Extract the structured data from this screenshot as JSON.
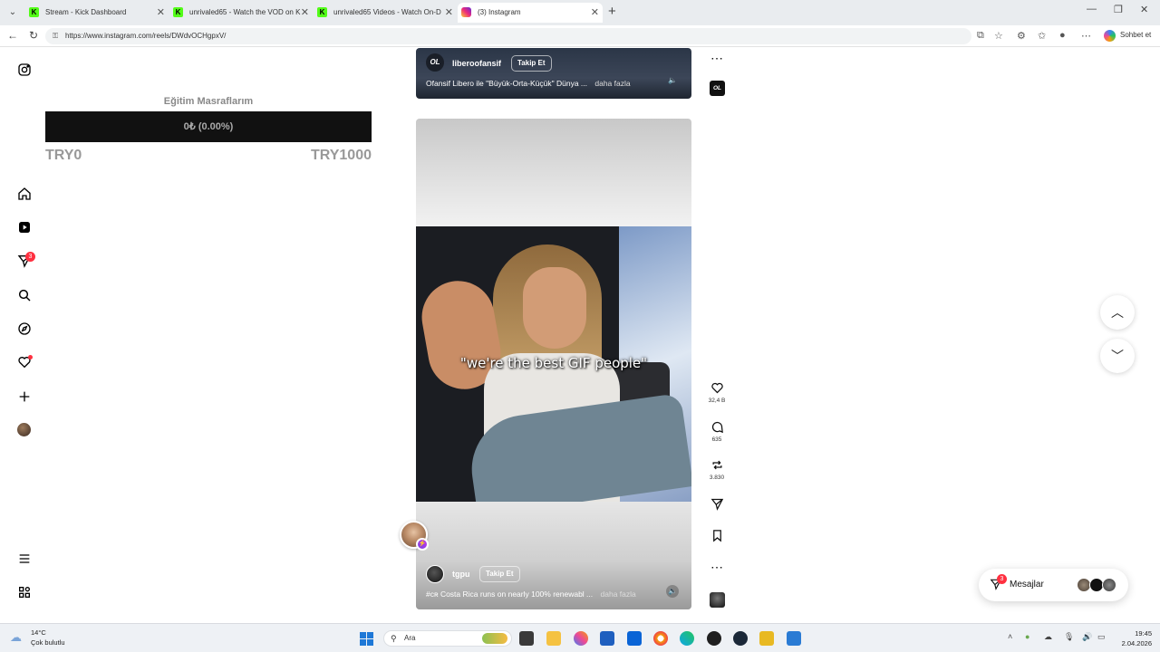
{
  "browser": {
    "tabs": [
      {
        "title": "Stream - Kick Dashboard",
        "icon": "kick-icon",
        "active": false
      },
      {
        "title": "unrivaled65 - Watch the VOD on K",
        "icon": "kick-icon",
        "active": false
      },
      {
        "title": "unrivaled65 Videos - Watch On-D",
        "icon": "kick-icon",
        "active": false
      },
      {
        "title": "(3) Instagram",
        "icon": "instagram-icon",
        "active": true
      }
    ],
    "url": "https://www.instagram.com/reels/DWdvOCHgpxV/",
    "copilot_label": "Sohbet et"
  },
  "nav": {
    "notifications_badge": "3"
  },
  "donation": {
    "title": "Eğitim Masraflarım",
    "progress_text": "0₺ (0.00%)",
    "progress_fraction": 0.0,
    "min_label": "TRY0",
    "max_label": "TRY1000"
  },
  "reels": [
    {
      "channel_logo": "OL",
      "author": "liberoofansif",
      "follow_label": "Takip Et",
      "caption": "Ofansif Libero ile \"Büyük-Orta-Küçük\" Dünya ...",
      "more_label": "daha fazla"
    },
    {
      "video_caption": "\"we're the best GIF people\"",
      "author": "tgpu",
      "follow_label": "Takip Et",
      "caption": "#ᴄʀ Costa Rica runs on nearly 100% renewabl ...",
      "more_label": "daha fazla",
      "likes": "32,4 B",
      "comments": "635",
      "reposts": "3.830"
    }
  ],
  "actions": {
    "top_logo": "OL"
  },
  "messages": {
    "label": "Mesajlar",
    "badge": "3"
  },
  "taskbar": {
    "temperature": "14°C",
    "weather": "Çok bulutlu",
    "search_placeholder": "Ara",
    "time": "19:45",
    "date": "2.04.2026"
  },
  "colors": {
    "accent_red": "#ff3040",
    "bar_dark": "#111111",
    "kick_green": "#53fc18"
  }
}
